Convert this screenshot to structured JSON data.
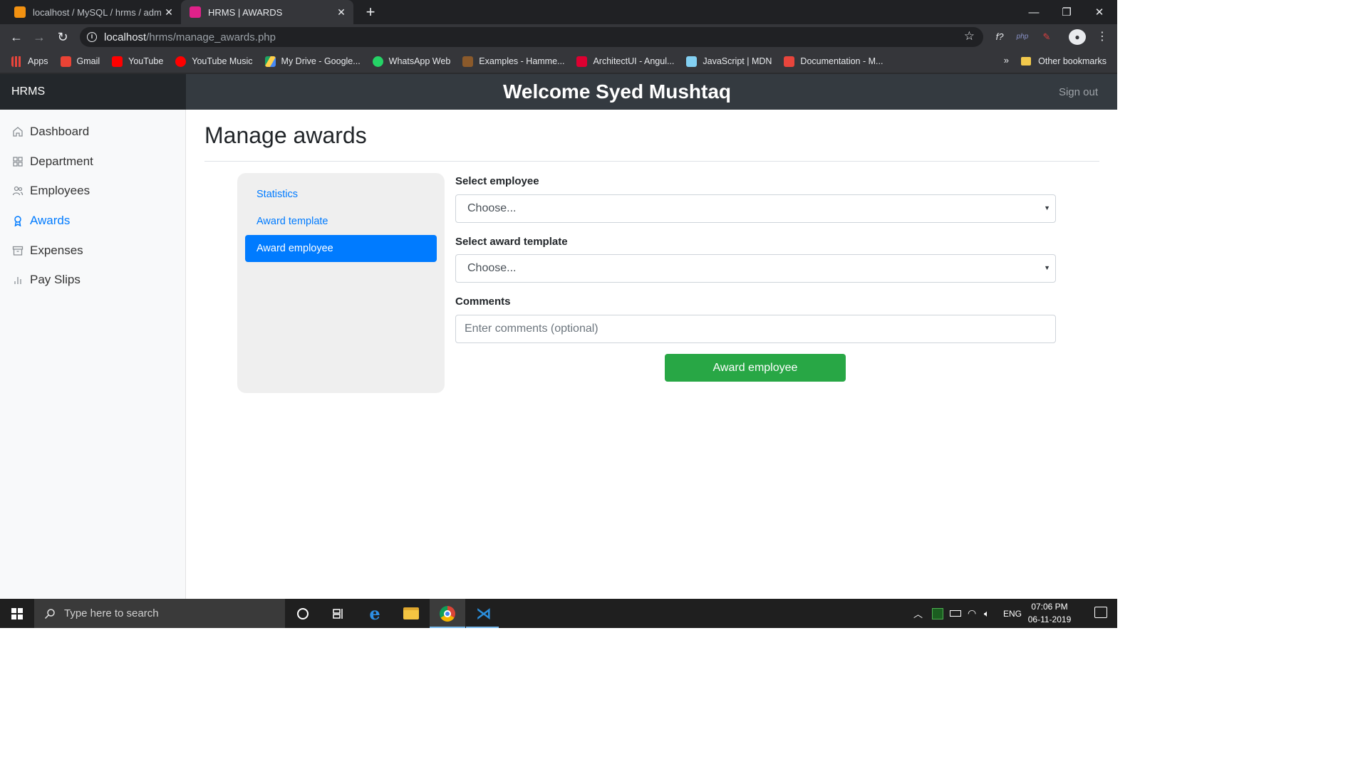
{
  "browser": {
    "tabs": [
      {
        "title": "localhost / MySQL / hrms / admin",
        "favicon_color": "#f29111"
      },
      {
        "title": "HRMS | AWARDS",
        "favicon_color": "#e0218a"
      }
    ],
    "new_tab_label": "+",
    "url_host": "localhost",
    "url_path": "/hrms/manage_awards.php",
    "bookmarks": [
      {
        "label": "Apps",
        "icon": "apps-grid-icon",
        "color": "#e8453c"
      },
      {
        "label": "Gmail",
        "icon": "gmail-icon",
        "color": "#ea4335"
      },
      {
        "label": "YouTube",
        "icon": "youtube-icon",
        "color": "#ff0000"
      },
      {
        "label": "YouTube Music",
        "icon": "youtube-music-icon",
        "color": "#ff0000"
      },
      {
        "label": "My Drive - Google...",
        "icon": "google-drive-icon",
        "color": "#1fa463"
      },
      {
        "label": "WhatsApp Web",
        "icon": "whatsapp-icon",
        "color": "#25d366"
      },
      {
        "label": "Examples - Hamme...",
        "icon": "hammer-icon",
        "color": "#8b5a2b"
      },
      {
        "label": "ArchitectUI - Angul...",
        "icon": "angular-icon",
        "color": "#dd0031"
      },
      {
        "label": "JavaScript | MDN",
        "icon": "mdn-icon",
        "color": "#83d0f2"
      },
      {
        "label": "Documentation - M...",
        "icon": "mui-icon",
        "color": "#e8453c"
      }
    ],
    "bookmarks_overflow": "»",
    "other_bookmarks": "Other bookmarks"
  },
  "app": {
    "brand": "HRMS",
    "welcome": "Welcome Syed Mushtaq",
    "signout": "Sign out",
    "sidebar": [
      {
        "label": "Dashboard",
        "icon": "home-icon",
        "active": false
      },
      {
        "label": "Department",
        "icon": "grid-icon",
        "active": false
      },
      {
        "label": "Employees",
        "icon": "users-icon",
        "active": false
      },
      {
        "label": "Awards",
        "icon": "award-icon",
        "active": true
      },
      {
        "label": "Expenses",
        "icon": "archive-icon",
        "active": false
      },
      {
        "label": "Pay Slips",
        "icon": "bar-chart-icon",
        "active": false
      }
    ],
    "page_title": "Manage awards",
    "subnav": [
      {
        "label": "Statistics",
        "active": false
      },
      {
        "label": "Award template",
        "active": false
      },
      {
        "label": "Award employee",
        "active": true
      }
    ],
    "form": {
      "employee_label": "Select employee",
      "employee_value": "Choose...",
      "template_label": "Select award template",
      "template_value": "Choose...",
      "comments_label": "Comments",
      "comments_placeholder": "Enter comments (optional)",
      "submit_label": "Award employee"
    },
    "colors": {
      "primary": "#007bff",
      "success": "#28a745",
      "navbar": "#343a40"
    }
  },
  "taskbar": {
    "search_placeholder": "Type here to search",
    "language": "ENG",
    "time": "07:06 PM",
    "date": "06-11-2019"
  }
}
